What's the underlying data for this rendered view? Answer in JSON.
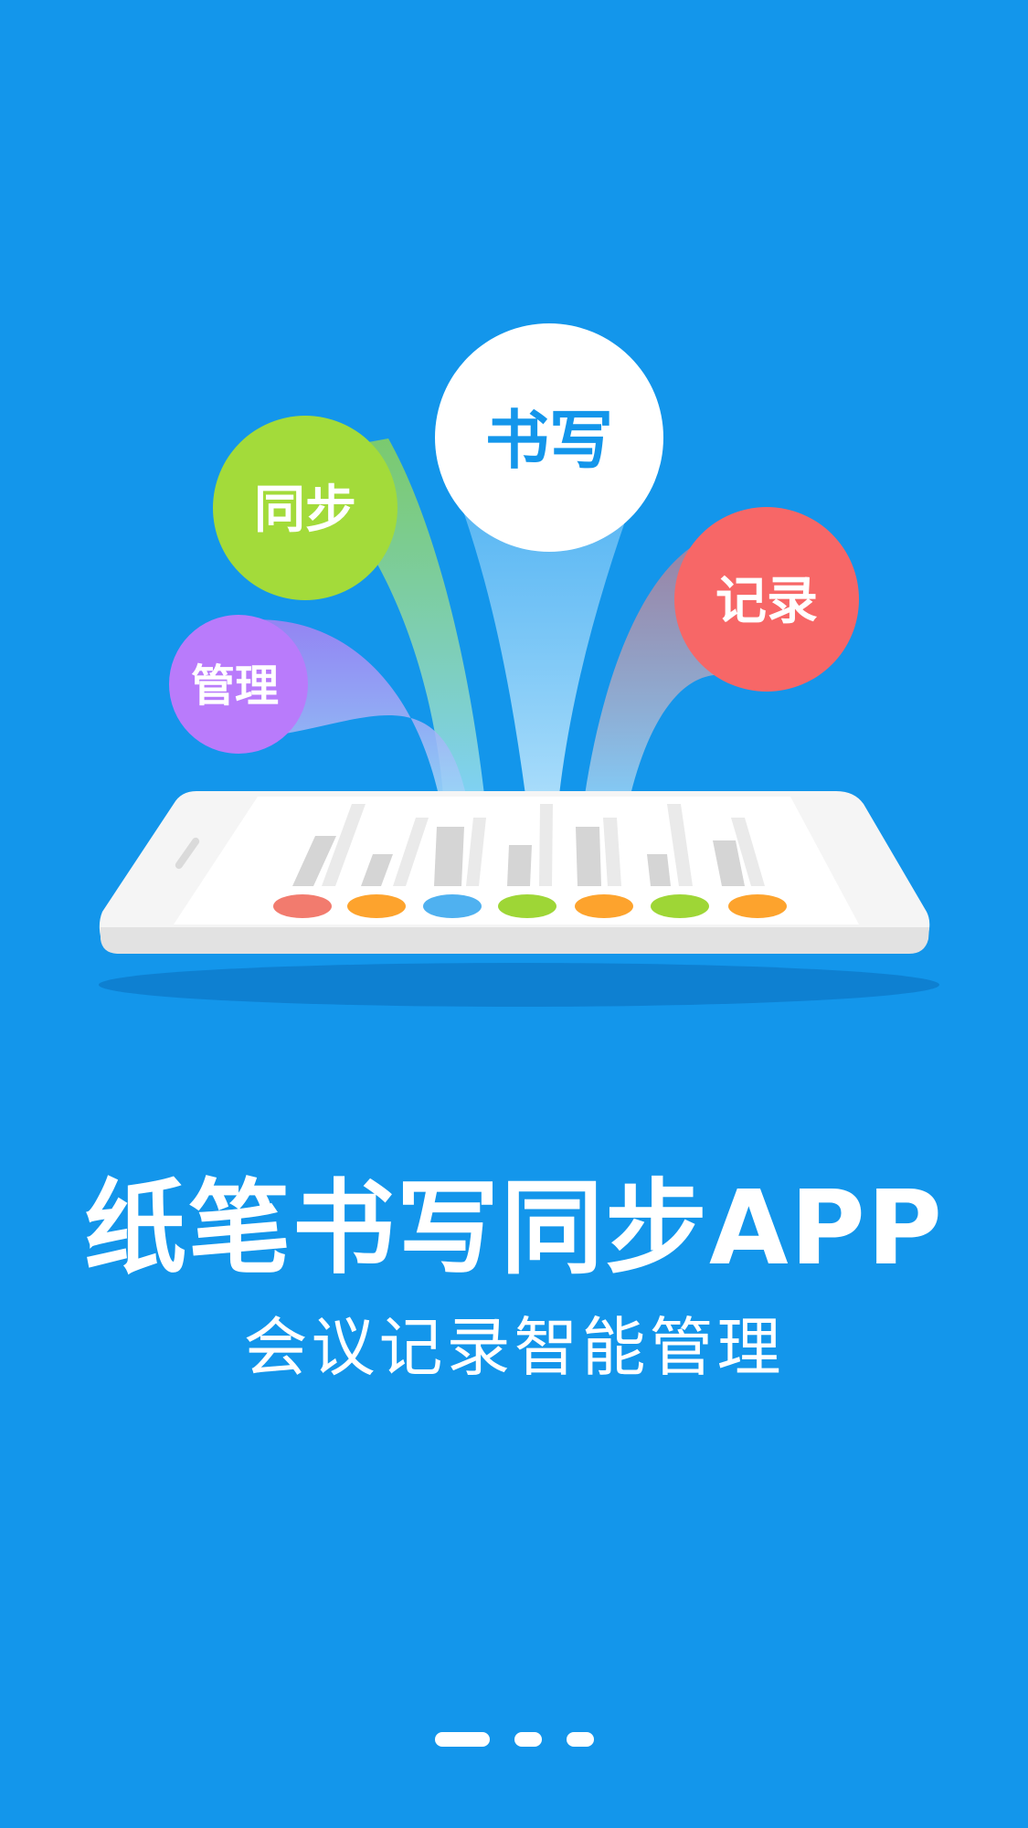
{
  "bubbles": {
    "write": {
      "label": "书写",
      "color": "#FFFFFF",
      "text_color": "#1396EB"
    },
    "sync": {
      "label": "同步",
      "color": "#A3DB3A",
      "text_color": "#FFFFFF"
    },
    "record": {
      "label": "记录",
      "color": "#F76767",
      "text_color": "#FFFFFF"
    },
    "manage": {
      "label": "管理",
      "color": "#B97BFB",
      "text_color": "#FFFFFF"
    }
  },
  "colors": {
    "background": "#1396EB",
    "phone_body": "#F5F5F5",
    "screen": "#FFFFFF",
    "dot_red": "#F27B6E",
    "dot_orange": "#FDA32D",
    "dot_blue": "#4FB1F0",
    "dot_green": "#9ED636"
  },
  "title": "纸笔书写同步APP",
  "subtitle": "会议记录智能管理",
  "pager": {
    "page_count": 3,
    "current_page": 1
  }
}
